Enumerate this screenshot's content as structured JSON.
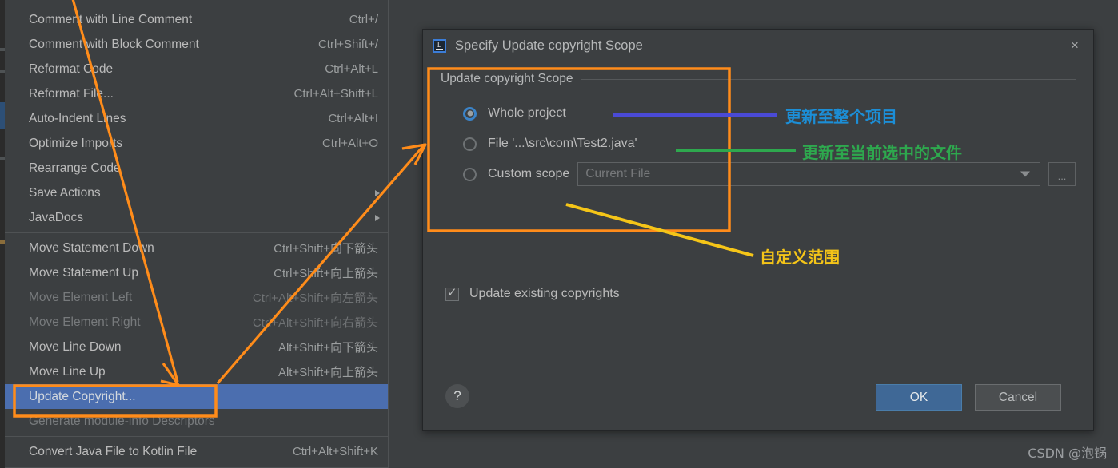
{
  "context_menu": {
    "items": [
      {
        "label": "Comment with Line Comment",
        "accel": "Ctrl+/",
        "state": "normal"
      },
      {
        "label": "Comment with Block Comment",
        "accel": "Ctrl+Shift+/",
        "state": "normal"
      },
      {
        "label": "Reformat Code",
        "accel": "Ctrl+Alt+L",
        "state": "normal"
      },
      {
        "label": "Reformat File...",
        "accel": "Ctrl+Alt+Shift+L",
        "state": "normal"
      },
      {
        "label": "Auto-Indent Lines",
        "accel": "Ctrl+Alt+I",
        "state": "normal"
      },
      {
        "label": "Optimize Imports",
        "accel": "Ctrl+Alt+O",
        "state": "normal"
      },
      {
        "label": "Rearrange Code",
        "accel": "",
        "state": "normal"
      },
      {
        "label": "Save Actions",
        "accel": "",
        "state": "submenu"
      },
      {
        "label": "JavaDocs",
        "accel": "",
        "state": "submenu"
      },
      {
        "separator": true
      },
      {
        "label": "Move Statement Down",
        "accel": "Ctrl+Shift+向下箭头",
        "state": "normal"
      },
      {
        "label": "Move Statement Up",
        "accel": "Ctrl+Shift+向上箭头",
        "state": "normal"
      },
      {
        "label": "Move Element Left",
        "accel": "Ctrl+Alt+Shift+向左箭头",
        "state": "disabled"
      },
      {
        "label": "Move Element Right",
        "accel": "Ctrl+Alt+Shift+向右箭头",
        "state": "disabled"
      },
      {
        "label": "Move Line Down",
        "accel": "Alt+Shift+向下箭头",
        "state": "normal"
      },
      {
        "label": "Move Line Up",
        "accel": "Alt+Shift+向上箭头",
        "state": "normal"
      },
      {
        "label": "Update Copyright...",
        "accel": "",
        "state": "selected"
      },
      {
        "label": "Generate module-info Descriptors",
        "accel": "",
        "state": "disabled"
      },
      {
        "separator": true
      },
      {
        "label": "Convert Java File to Kotlin File",
        "accel": "Ctrl+Alt+Shift+K",
        "state": "normal"
      }
    ]
  },
  "dialog": {
    "title": "Specify Update copyright Scope",
    "icon": "intellij-idea-icon",
    "close_label": "×",
    "group_title": "Update copyright Scope",
    "options": [
      {
        "label": "Whole project",
        "checked": true
      },
      {
        "label": "File '...\\src\\com\\Test2.java'",
        "checked": false
      },
      {
        "label": "Custom scope",
        "checked": false
      }
    ],
    "scope_field_placeholder": "Current File",
    "ellipsis_button_label": "...",
    "checkbox": {
      "label": "Update existing copyrights",
      "checked": true
    },
    "help_label": "?",
    "ok_label": "OK",
    "cancel_label": "Cancel"
  },
  "annotations": {
    "blue": {
      "text": "更新至整个项目",
      "color": "#1c8ed6",
      "line_color": "#4a4ad6"
    },
    "green": {
      "text": "更新至当前选中的文件",
      "color": "#2ea84e",
      "line_color": "#2ea84e"
    },
    "yellow": {
      "text": "自定义范围",
      "color": "#f5c518",
      "line_color": "#f5c518"
    },
    "highlight_color": "#ff8c1a"
  },
  "watermark": {
    "text": "CSDN @泡锅"
  }
}
